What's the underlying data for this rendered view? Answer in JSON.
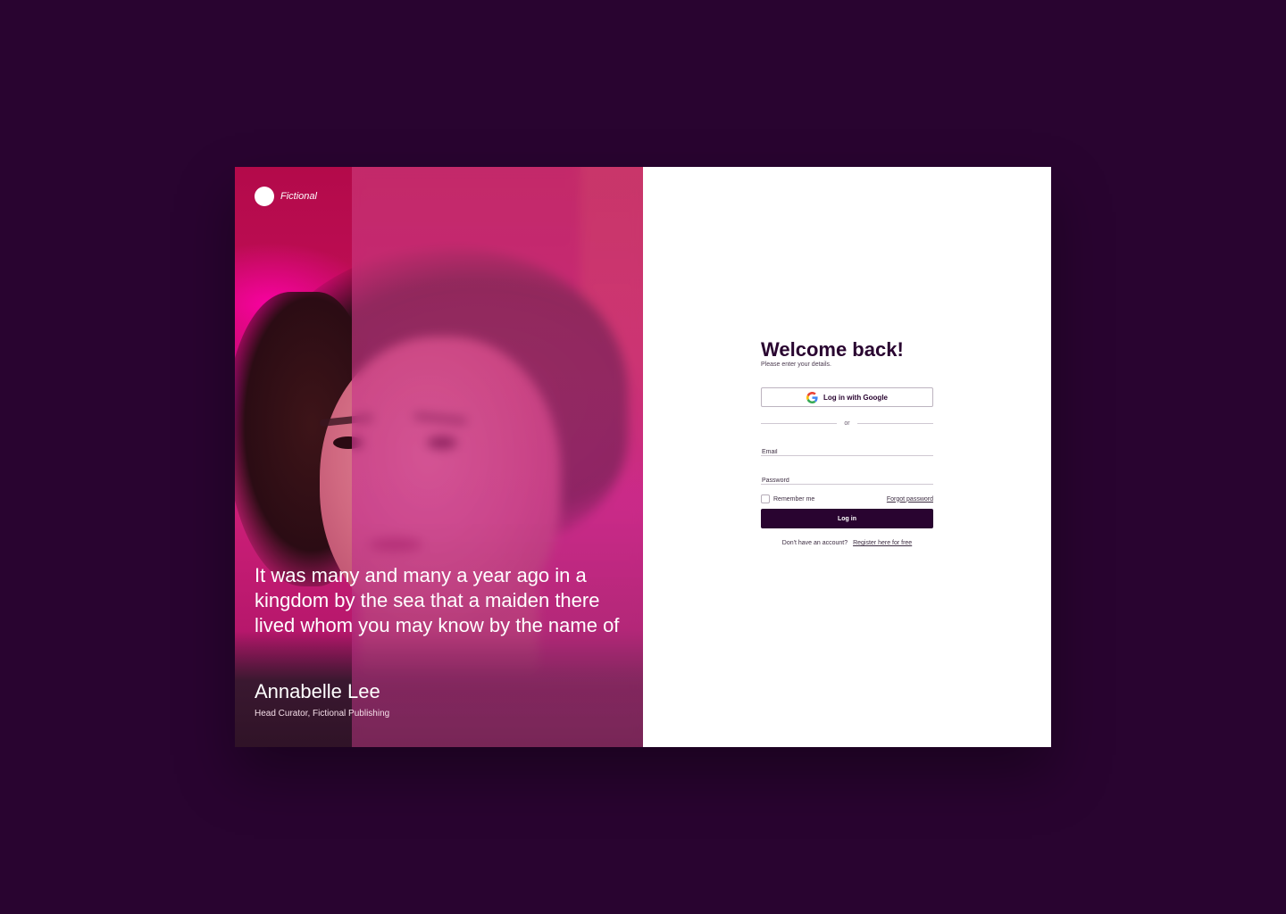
{
  "brand": {
    "name": "Fictional"
  },
  "hero": {
    "quote": "It was many and many a year ago in a kingdom by the sea that a maiden there lived whom you may know by the name of",
    "author": "Annabelle Lee",
    "author_role": "Head Curator, Fictional Publishing"
  },
  "form": {
    "title": "Welcome back!",
    "subtitle": "Please enter your details.",
    "google_label": "Log in with Google",
    "divider_text": "or",
    "email_placeholder": "Email",
    "password_placeholder": "Password",
    "remember_label": "Remember me",
    "forgot_label": "Forgot password",
    "login_label": "Log in",
    "register_prompt": "Don't have an account?",
    "register_link": "Register here for free"
  },
  "colors": {
    "background": "#290430",
    "primary": "#290430",
    "panel": "#ffffff",
    "hero_accent": "#c2186a"
  }
}
